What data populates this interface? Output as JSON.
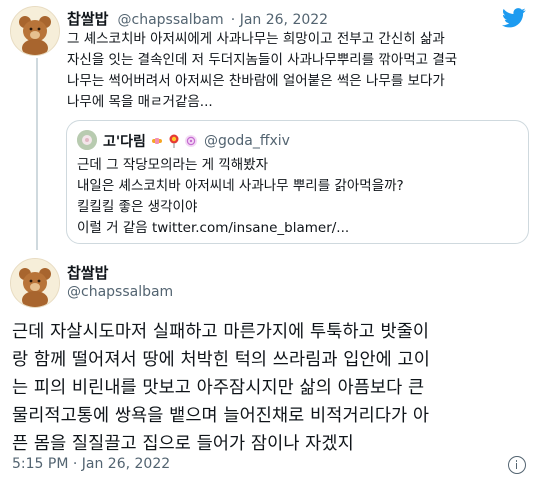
{
  "colors": {
    "twitter_blue": "#1d9bf0",
    "text": "#0f1419",
    "muted": "#536471",
    "border": "#cfd9de"
  },
  "icons": {
    "logo": "twitter-bird-icon",
    "info": "info-icon"
  },
  "reply_tweet": {
    "name": "찹쌀밥",
    "handle": "@chapssalbam",
    "date": "· Jan 26, 2022",
    "lines": [
      "그 셰스코치바 아저씨에게 사과나무는 희망이고 전부고 간신히 삶과",
      "자신을 잇는 결속인데 저 두더지놈들이 사과나무뿌리를 깎아먹고 결국",
      "나무는 썩어버려서 아저씨은 찬바람에 얼어붙은 썩은 나무를 보다가",
      "나무에 목을 매ㄹ거같음..."
    ]
  },
  "quoted_tweet": {
    "name": "고'다림",
    "handle": "@goda_ffxiv",
    "lines": [
      "근데 그 작당모의라는 게 끽해봤자",
      "내일은 셰스코치바 아저씨네 사과나무 뿌리를 갉아먹을까?",
      "킬킬킬 좋은 생각이야",
      "이럴 거 같음 twitter.com/insane_blamer/..."
    ]
  },
  "main_tweet": {
    "name": "찹쌀밥",
    "handle": "@chapssalbam",
    "lines": [
      "근데 자살시도마저 실패하고 마른가지에 투툭하고 밧줄이",
      "랑 함께 떨어져서 땅에 처박힌 턱의 쓰라림과 입안에 고이",
      "는 피의 비린내를 맛보고 아주잠시지만 삶의 아픔보다 큰",
      "물리적고통에 쌍욕을 뱉으며 늘어진채로 비적거리다가 아",
      "픈 몸을 질질끌고 집으로 들어가 잠이나 자겠지"
    ],
    "timestamp": "5:15 PM · Jan 26, 2022"
  }
}
